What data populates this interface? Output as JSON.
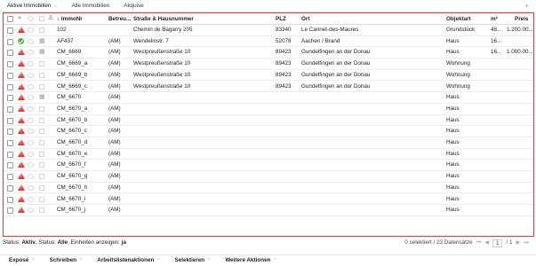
{
  "tabs": [
    {
      "label": "Aktive Immobilien",
      "has_menu": true
    },
    {
      "label": "Alle Immobilien",
      "has_menu": false
    },
    {
      "label": "Akquise",
      "has_menu": false
    }
  ],
  "add_tab_label": "+",
  "table": {
    "columns": {
      "immonr": "ImmoNr",
      "betreu": "Betreu...",
      "strasse": "Straße & Hausnummer",
      "plz": "PLZ",
      "ort": "Ort",
      "objektart": "Objektart",
      "m2": "m²",
      "preis": "Preis"
    },
    "sort_indicator": "↓",
    "rows": [
      {
        "status": "warn",
        "second": "",
        "building": false,
        "immonr": "102",
        "betreu": "",
        "strasse": "Chemin de Bagarry 205",
        "plz": "83340",
        "ort": "Le Cannet-des-Maures",
        "objektart": "Grundstück",
        "m2": "48...",
        "preis": "1.200.00..."
      },
      {
        "status": "ok",
        "second": "",
        "building": true,
        "immonr": "AF437",
        "betreu": "(AM)",
        "strasse": "Wendelinstr. 7",
        "plz": "52078",
        "ort": "Aachen / Brand",
        "objektart": "Haus",
        "m2": "16...",
        "preis": ""
      },
      {
        "status": "warn",
        "second": "",
        "building": true,
        "immonr": "CM_6669",
        "betreu": "(AM)",
        "strasse": "Westpreußenstraße 10",
        "plz": "89423",
        "ort": "Gundelfingen an der Donau",
        "objektart": "Haus",
        "m2": "16...",
        "preis": "1.000.00..."
      },
      {
        "status": "warn",
        "second": "",
        "building": false,
        "immonr": "CM_6669_a",
        "betreu": "(AM)",
        "strasse": "Westpreußenstraße 10",
        "plz": "89423",
        "ort": "Gundelfingen an der Donau",
        "objektart": "Wohnung",
        "m2": "",
        "preis": ""
      },
      {
        "status": "warn",
        "second": "",
        "building": false,
        "immonr": "CM_6669_b",
        "betreu": "(AM)",
        "strasse": "Westpreußenstraße 10",
        "plz": "89423",
        "ort": "Gundelfingen an der Donau",
        "objektart": "Wohnung",
        "m2": "",
        "preis": ""
      },
      {
        "status": "warn",
        "second": "",
        "building": false,
        "immonr": "CM_6669_c",
        "betreu": "(AM)",
        "strasse": "Westpreußenstraße 10",
        "plz": "89423",
        "ort": "Gundelfingen an der Donau",
        "objektart": "Wohnung",
        "m2": "",
        "preis": ""
      },
      {
        "status": "warn",
        "second": "",
        "building": true,
        "immonr": "CM_6670",
        "betreu": "(AM)",
        "strasse": "",
        "plz": "",
        "ort": "",
        "objektart": "Haus",
        "m2": "",
        "preis": ""
      },
      {
        "status": "warn",
        "second": "",
        "building": false,
        "immonr": "CM_6670_a",
        "betreu": "(AM)",
        "strasse": "",
        "plz": "",
        "ort": "",
        "objektart": "Haus",
        "m2": "",
        "preis": ""
      },
      {
        "status": "warn",
        "second": "",
        "building": false,
        "immonr": "CM_6670_b",
        "betreu": "(AM)",
        "strasse": "",
        "plz": "",
        "ort": "",
        "objektart": "Haus",
        "m2": "",
        "preis": ""
      },
      {
        "status": "warn",
        "second": "",
        "building": false,
        "immonr": "CM_6670_c",
        "betreu": "(AM)",
        "strasse": "",
        "plz": "",
        "ort": "",
        "objektart": "Haus",
        "m2": "",
        "preis": ""
      },
      {
        "status": "warn",
        "second": "",
        "building": false,
        "immonr": "CM_6670_d",
        "betreu": "(AM)",
        "strasse": "",
        "plz": "",
        "ort": "",
        "objektart": "Haus",
        "m2": "",
        "preis": ""
      },
      {
        "status": "warn",
        "second": "",
        "building": false,
        "immonr": "CM_6670_e",
        "betreu": "(AM)",
        "strasse": "",
        "plz": "",
        "ort": "",
        "objektart": "Haus",
        "m2": "",
        "preis": ""
      },
      {
        "status": "warn",
        "second": "",
        "building": false,
        "immonr": "CM_6670_f",
        "betreu": "(AM)",
        "strasse": "",
        "plz": "",
        "ort": "",
        "objektart": "Haus",
        "m2": "",
        "preis": ""
      },
      {
        "status": "warn",
        "second": "",
        "building": false,
        "immonr": "CM_6670_g",
        "betreu": "(AM)",
        "strasse": "",
        "plz": "",
        "ort": "",
        "objektart": "Haus",
        "m2": "",
        "preis": ""
      },
      {
        "status": "warn",
        "second": "",
        "building": false,
        "immonr": "CM_6670_h",
        "betreu": "(AM)",
        "strasse": "",
        "plz": "",
        "ort": "",
        "objektart": "Haus",
        "m2": "",
        "preis": ""
      },
      {
        "status": "warn",
        "second": "",
        "building": false,
        "immonr": "CM_6670_i",
        "betreu": "(AM)",
        "strasse": "",
        "plz": "",
        "ort": "",
        "objektart": "Haus",
        "m2": "",
        "preis": ""
      },
      {
        "status": "warn",
        "second": "",
        "building": false,
        "immonr": "CM_6670_j",
        "betreu": "(AM)",
        "strasse": "",
        "plz": "",
        "ort": "",
        "objektart": "Haus",
        "m2": "",
        "preis": ""
      }
    ]
  },
  "status_bar": {
    "prefix": "Status: ",
    "status_value": "Aktiv",
    "middle": ", Status: ",
    "status2_value": "Alle",
    "units_label": ", Einheiten anzeigen: ",
    "units_value": "ja",
    "selection": "0 selektiert / 23 Datensätze",
    "page_current": "1",
    "page_total": "/ 1"
  },
  "actions": [
    {
      "label": "Exposé"
    },
    {
      "label": "Schreiben"
    },
    {
      "label": "Arbeitslistenaktionen"
    },
    {
      "label": "Selektieren"
    },
    {
      "label": "Weitere Aktionen"
    }
  ],
  "icons": {
    "warning": "warning-triangle-icon",
    "ok": "check-circle-icon",
    "building": "building-icon",
    "pin": "pin-icon",
    "cloud": "cloud-icon",
    "user": "user-icon"
  },
  "colors": {
    "frame_border": "#e53935",
    "warning": "#e53935",
    "ok": "#4caf50"
  }
}
